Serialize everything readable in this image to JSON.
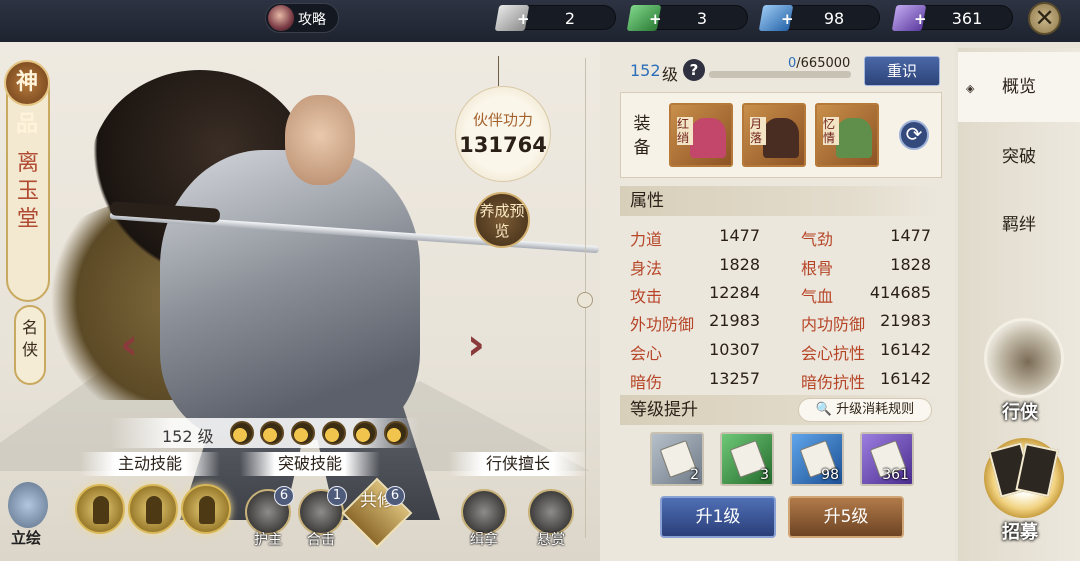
{
  "topbar": {
    "guide_label": "攻略",
    "resources": [
      {
        "icon": "scroll-gray-icon",
        "color": "#c7c7c7",
        "value": "2"
      },
      {
        "icon": "scroll-green-icon",
        "color": "#3fa64a",
        "value": "3"
      },
      {
        "icon": "scroll-blue-icon",
        "color": "#3f8fd8",
        "value": "98"
      },
      {
        "icon": "scroll-purple-icon",
        "color": "#7d5cc9",
        "value": "361"
      }
    ]
  },
  "character": {
    "rank_badge": "神品",
    "name": "离玉堂",
    "title": "名侠",
    "power_label": "伙伴功力",
    "power_value": "131764",
    "nurture_label": "养成预览",
    "level_text": "152 级"
  },
  "skills": {
    "active_header": "主动技能",
    "breakthrough_header": "突破技能",
    "specialty_header": "行侠擅长",
    "breakthrough": [
      {
        "label": "护主",
        "count": "6"
      },
      {
        "label": "合击",
        "count": "1"
      }
    ],
    "gongxiu_label": "共修",
    "gongxiu_count": "6",
    "specialty": [
      {
        "label": "缉拿"
      },
      {
        "label": "悬赏"
      }
    ],
    "portrait_label": "立绘"
  },
  "panel": {
    "level_num": "152",
    "level_suffix": "级",
    "help": "?",
    "exp_current": "0",
    "exp_total": "/665000",
    "reset_label": "重识",
    "equip_label": "装备",
    "equipment": [
      {
        "name": "红绡",
        "color": "#c2476a"
      },
      {
        "name": "月落",
        "color": "#4a2d22"
      },
      {
        "name": "忆情",
        "color": "#5f8f4a"
      }
    ],
    "attr_header": "属性",
    "attributes": [
      {
        "name": "力道",
        "value": "1477"
      },
      {
        "name": "气劲",
        "value": "1477"
      },
      {
        "name": "身法",
        "value": "1828"
      },
      {
        "name": "根骨",
        "value": "1828"
      },
      {
        "name": "攻击",
        "value": "12284"
      },
      {
        "name": "气血",
        "value": "414685"
      },
      {
        "name": "外功防御",
        "value": "21983"
      },
      {
        "name": "内功防御",
        "value": "21983"
      },
      {
        "name": "会心",
        "value": "10307"
      },
      {
        "name": "会心抗性",
        "value": "16142"
      },
      {
        "name": "暗伤",
        "value": "13257"
      },
      {
        "name": "暗伤抗性",
        "value": "16142"
      }
    ],
    "upgrade_header": "等级提升",
    "rules_label": "升级消耗规则",
    "books": [
      {
        "color": "#8e9aa7",
        "count": "2"
      },
      {
        "color": "#3c9b47",
        "count": "3"
      },
      {
        "color": "#2f78c8",
        "count": "98"
      },
      {
        "color": "#6b47b8",
        "count": "361"
      }
    ],
    "up1_label": "升1级",
    "up5_label": "升5级"
  },
  "sidebar": {
    "tabs": [
      "概览",
      "突破",
      "羁绊"
    ],
    "xingxia_label": "行侠",
    "zhaomu_label": "招募"
  }
}
